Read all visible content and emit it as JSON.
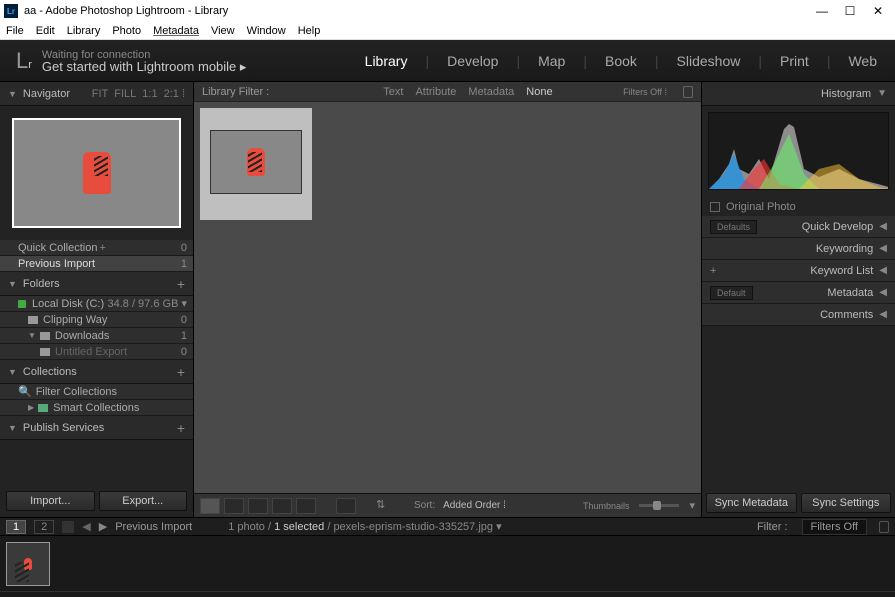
{
  "window": {
    "title": "aa - Adobe Photoshop Lightroom - Library"
  },
  "menu": [
    "File",
    "Edit",
    "Library",
    "Photo",
    "Metadata",
    "View",
    "Window",
    "Help"
  ],
  "header": {
    "waiting": "Waiting for connection",
    "mobile": "Get started with Lightroom mobile  ▸",
    "modules": [
      "Library",
      "Develop",
      "Map",
      "Book",
      "Slideshow",
      "Print",
      "Web"
    ],
    "active": "Library"
  },
  "left": {
    "navigator": {
      "title": "Navigator",
      "opts": [
        "FIT",
        "FILL",
        "1:1",
        "2:1 ⁞"
      ]
    },
    "quick": {
      "label": "Quick Collection",
      "count": "0"
    },
    "prev": {
      "label": "Previous Import",
      "count": "1"
    },
    "folders": {
      "title": "Folders",
      "disk": "Local Disk (C:)",
      "diskinfo": "34.8 / 97.6 GB ▾",
      "items": [
        {
          "label": "Clipping Way",
          "count": "0"
        },
        {
          "label": "Downloads",
          "count": "1",
          "expanded": true
        },
        {
          "label": "Untitled Export",
          "count": "0",
          "sub": true
        }
      ]
    },
    "collections": {
      "title": "Collections",
      "filter": "Filter Collections",
      "smart": "Smart Collections"
    },
    "publish": {
      "title": "Publish Services"
    },
    "import": "Import...",
    "export": "Export..."
  },
  "center": {
    "filter": {
      "label": "Library Filter :",
      "text": "Text",
      "attr": "Attribute",
      "meta": "Metadata",
      "none": "None",
      "off": "Filters Off ⁞"
    },
    "toolbar": {
      "sort": "Sort:",
      "order": "Added Order  ⁞",
      "thumbs": "Thumbnails"
    }
  },
  "right": {
    "histogram": "Histogram",
    "orig": "Original Photo",
    "panels": [
      {
        "label": "Quick Develop",
        "def": "Defaults"
      },
      {
        "label": "Keywording"
      },
      {
        "label": "Keyword List",
        "plus": true
      },
      {
        "label": "Metadata",
        "def": "Default"
      },
      {
        "label": "Comments"
      }
    ],
    "syncmeta": "Sync Metadata",
    "syncset": "Sync Settings"
  },
  "status": {
    "pages": [
      "1",
      "2"
    ],
    "prev": "Previous Import",
    "count": "1 photo /",
    "sel": "1 selected",
    "file": "/ pexels-eprism-studio-335257.jpg  ▾",
    "filter": "Filter :",
    "filtersel": "Filters Off"
  }
}
